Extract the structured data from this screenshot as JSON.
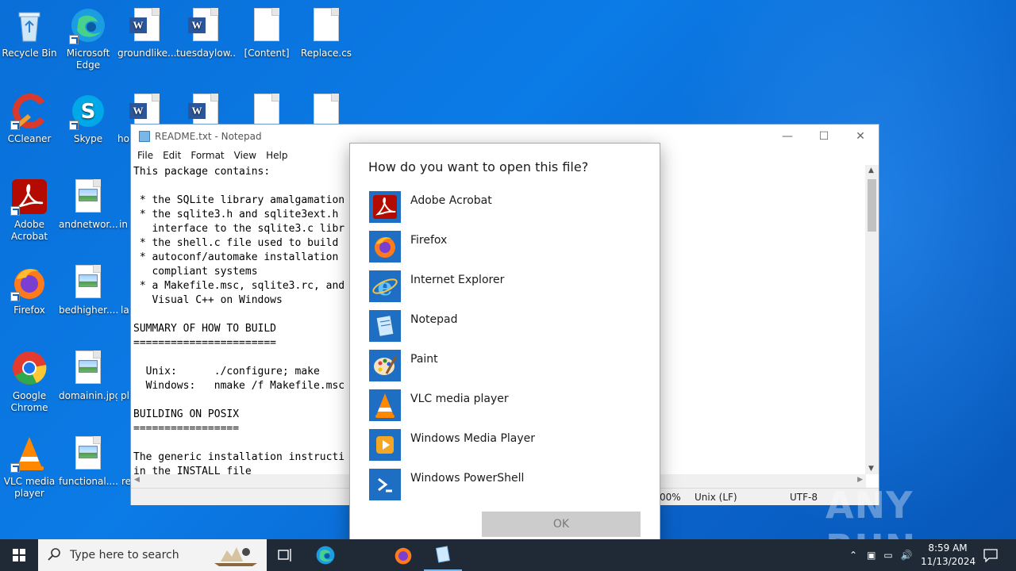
{
  "desktop": {
    "icons": [
      {
        "label": "Recycle Bin"
      },
      {
        "label": "Microsoft Edge"
      },
      {
        "label": "groundlike...."
      },
      {
        "label": "tuesdaylow...."
      },
      {
        "label": "[Content]"
      },
      {
        "label": "Replace.cs"
      },
      {
        "label": "CCleaner"
      },
      {
        "label": "Skype"
      },
      {
        "label": "ho"
      },
      {
        "label": "Adobe Acrobat"
      },
      {
        "label": "andnetwor...."
      },
      {
        "label": "in"
      },
      {
        "label": "Firefox"
      },
      {
        "label": "bedhigher...."
      },
      {
        "label": "la"
      },
      {
        "label": "Google Chrome"
      },
      {
        "label": "domainin.jpg"
      },
      {
        "label": "pl"
      },
      {
        "label": "VLC media player"
      },
      {
        "label": "functional...."
      },
      {
        "label": "re"
      }
    ]
  },
  "notepad": {
    "title": "README.txt - Notepad",
    "menu": [
      "File",
      "Edit",
      "Format",
      "View",
      "Help"
    ],
    "content": "This package contains:\n\n * the SQLite library amalgamation\n * the sqlite3.h and sqlite3ext.h\n   interface to the sqlite3.c libr\n * the shell.c file used to build\n * autoconf/automake installation\n   compliant systems\n * a Makefile.msc, sqlite3.rc, and\n   Visual C++ on Windows\n\nSUMMARY OF HOW TO BUILD\n=======================\n\n  Unix:      ./configure; make\n  Windows:   nmake /f Makefile.msc\n\nBUILDING ON POSIX\n=================\n\nThe generic installation instructi\nin the INSTALL file",
    "status": {
      "zoom": "00%",
      "line_ending": "Unix (LF)",
      "encoding": "UTF-8"
    }
  },
  "dialog": {
    "title": "How do you want to open this file?",
    "apps": [
      {
        "name": "Adobe Acrobat",
        "icon": "adobe-acrobat-icon"
      },
      {
        "name": "Firefox",
        "icon": "firefox-icon"
      },
      {
        "name": "Internet Explorer",
        "icon": "internet-explorer-icon"
      },
      {
        "name": "Notepad",
        "icon": "notepad-icon"
      },
      {
        "name": "Paint",
        "icon": "paint-icon"
      },
      {
        "name": "VLC media player",
        "icon": "vlc-icon"
      },
      {
        "name": "Windows Media Player",
        "icon": "windows-media-player-icon"
      },
      {
        "name": "Windows PowerShell",
        "icon": "powershell-icon"
      }
    ],
    "ok_label": "OK"
  },
  "taskbar": {
    "search_placeholder": "Type here to search",
    "time": "8:59 AM",
    "date": "11/13/2024"
  },
  "watermark": "ANY RUN",
  "colors": {
    "app_tile": "#1e6fc4",
    "desktop_blue": "#0b7be6",
    "taskbar": "#1f2a36"
  }
}
